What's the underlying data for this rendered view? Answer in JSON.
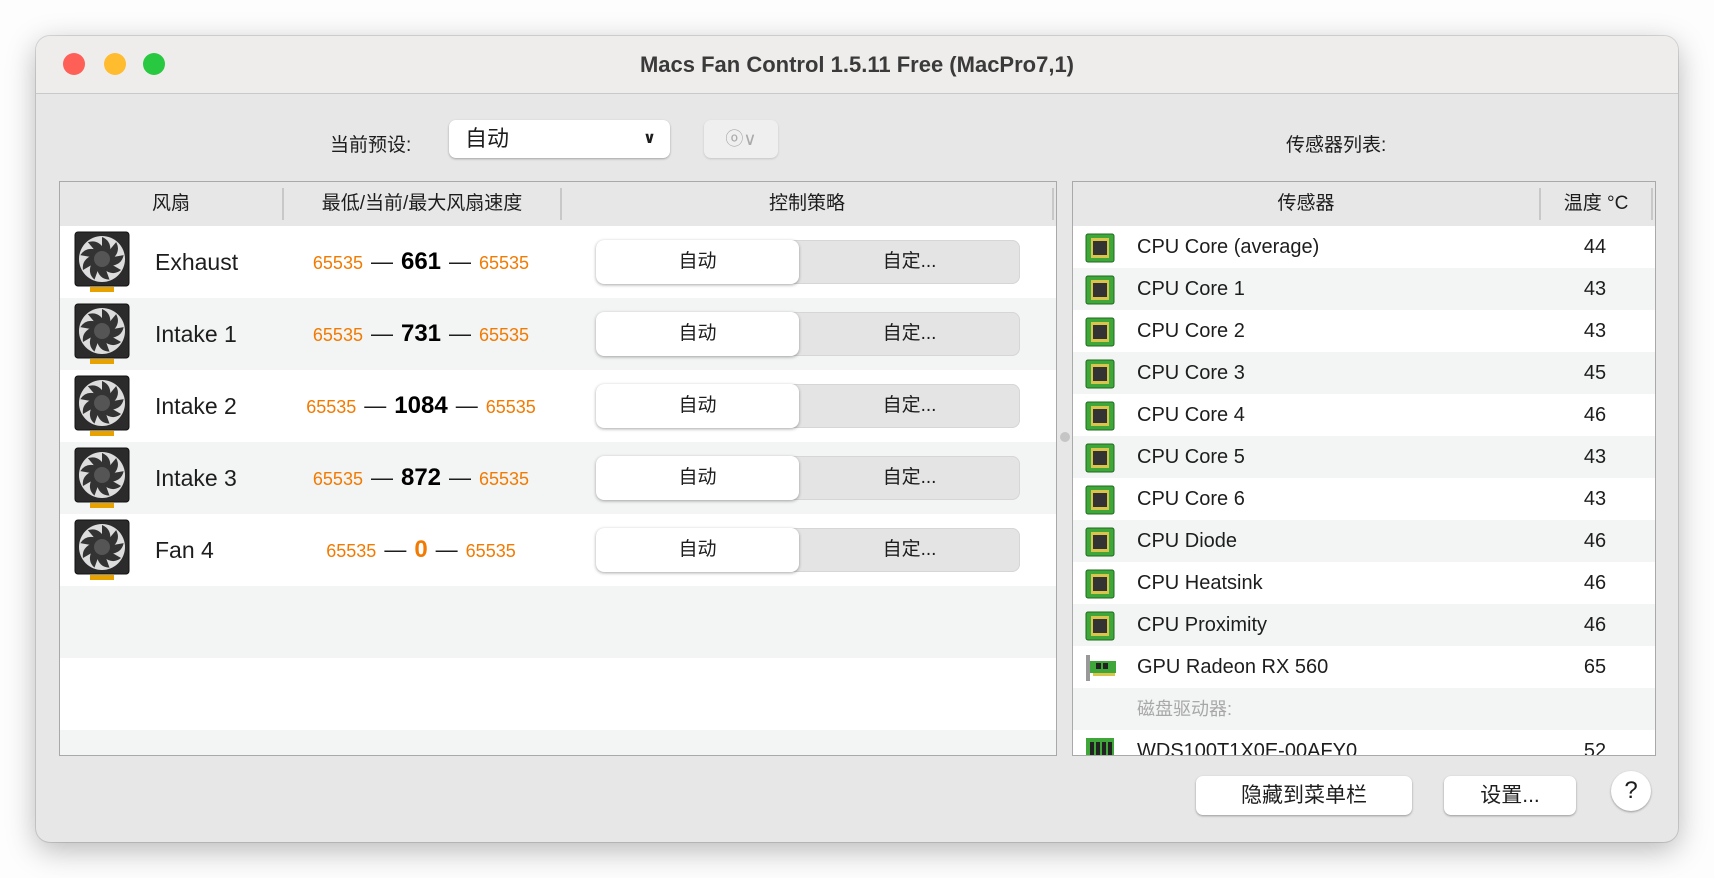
{
  "window": {
    "title": "Macs Fan Control 1.5.11 Free (MacPro7,1)"
  },
  "colors": {
    "close": "#fe5f57",
    "minimize": "#febc2e",
    "zoom": "#28c840",
    "speed_limit": "#f27a00",
    "accent_zero": "#f27a00"
  },
  "preset": {
    "label": "当前预设:",
    "value": "自动",
    "action_icon": "ellipsis-circle-icon"
  },
  "sensors_label": "传感器列表:",
  "fan_table": {
    "headers": [
      "风扇",
      "最低/当前/最大风扇速度",
      "控制策略"
    ],
    "rows": [
      {
        "name": "Exhaust",
        "min": "65535",
        "current": "661",
        "max": "65535",
        "auto": "自动",
        "custom": "自定...",
        "current_zero": false
      },
      {
        "name": "Intake 1",
        "min": "65535",
        "current": "731",
        "max": "65535",
        "auto": "自动",
        "custom": "自定...",
        "current_zero": false
      },
      {
        "name": "Intake 2",
        "min": "65535",
        "current": "1084",
        "max": "65535",
        "auto": "自动",
        "custom": "自定...",
        "current_zero": false
      },
      {
        "name": "Intake 3",
        "min": "65535",
        "current": "872",
        "max": "65535",
        "auto": "自动",
        "custom": "自定...",
        "current_zero": false
      },
      {
        "name": "Fan 4",
        "min": "65535",
        "current": "0",
        "max": "65535",
        "auto": "自动",
        "custom": "自定...",
        "current_zero": true
      }
    ],
    "dash": "—"
  },
  "sensor_table": {
    "headers": [
      "传感器",
      "温度 °C"
    ],
    "rows": [
      {
        "type": "cpu",
        "name": "CPU Core (average)",
        "temp": "44"
      },
      {
        "type": "cpu",
        "name": "CPU Core 1",
        "temp": "43"
      },
      {
        "type": "cpu",
        "name": "CPU Core 2",
        "temp": "43"
      },
      {
        "type": "cpu",
        "name": "CPU Core 3",
        "temp": "45"
      },
      {
        "type": "cpu",
        "name": "CPU Core 4",
        "temp": "46"
      },
      {
        "type": "cpu",
        "name": "CPU Core 5",
        "temp": "43"
      },
      {
        "type": "cpu",
        "name": "CPU Core 6",
        "temp": "43"
      },
      {
        "type": "cpu",
        "name": "CPU Diode",
        "temp": "46"
      },
      {
        "type": "cpu",
        "name": "CPU Heatsink",
        "temp": "46"
      },
      {
        "type": "cpu",
        "name": "CPU Proximity",
        "temp": "46"
      },
      {
        "type": "gpu",
        "name": "GPU Radeon RX 560",
        "temp": "65"
      },
      {
        "type": "section",
        "name": "磁盘驱动器:",
        "temp": ""
      },
      {
        "type": "disk",
        "name": "WDS100T1X0E-00AFY0",
        "temp": "52"
      }
    ]
  },
  "buttons": {
    "hide": "隐藏到菜单栏",
    "settings": "设置...",
    "help": "?"
  }
}
